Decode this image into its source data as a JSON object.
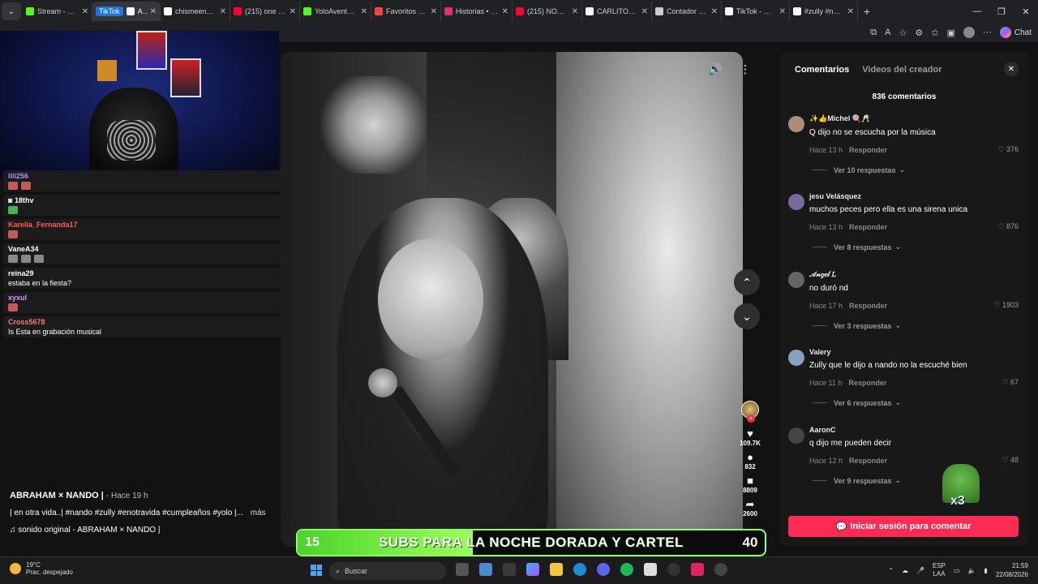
{
  "browser": {
    "tabs": [
      {
        "title": "Stream - Kick",
        "color": "#53fc18"
      },
      {
        "title": "ABRAHAM",
        "color": "#ffffff",
        "active": true,
        "pill": "TikTok"
      },
      {
        "title": "chismeenuna",
        "color": "#ffffff"
      },
      {
        "title": "(215) one dir",
        "color": "#ff0033"
      },
      {
        "title": "YoloAventuras",
        "color": "#53fc18"
      },
      {
        "title": "Favoritos | My",
        "color": "#ff4040"
      },
      {
        "title": "Historias • Inst",
        "color": "#e1306c"
      },
      {
        "title": "(215) NOS VA",
        "color": "#ff0033"
      },
      {
        "title": "CARLITOS TV",
        "color": "#ffffff"
      },
      {
        "title": "Contador en v",
        "color": "#cccccc"
      },
      {
        "title": "TikTok - Make",
        "color": "#ffffff"
      },
      {
        "title": "#zully #nando",
        "color": "#ffffff"
      }
    ],
    "chat_label": "Chat"
  },
  "video": {
    "author": "ABRAHAM × NANDO |",
    "time": "- Hace 19 h",
    "description": "| en otra vida..| #nando #zully #enotravida #cumpleaños #yolo |...",
    "more": "más",
    "sound": "sonido original - ABRAHAM × NANDO |",
    "likes": "109.7K",
    "comments": "832",
    "saves": "8809",
    "shares": "2600"
  },
  "stream_chat": [
    {
      "user": "lili256",
      "color": "#b58cff",
      "emotes": [
        "r",
        "r"
      ]
    },
    {
      "user": "18thv",
      "color": "#ffffff",
      "emotes": [
        "g"
      ],
      "badge": true
    },
    {
      "user": "Karelia_Fernanda17",
      "color": "#ff5a5a",
      "emotes": [
        "r"
      ]
    },
    {
      "user": "VaneA34",
      "color": "#ffffff",
      "emotes": [
        "gr",
        "gr",
        "gr"
      ]
    },
    {
      "user": "reina29",
      "color": "#ffffff",
      "msg": "estaba en la fiesta?"
    },
    {
      "user": "xyxul",
      "color": "#d59bff",
      "emotes": [
        "r"
      ]
    },
    {
      "user": "Cross5678",
      "color": "#ff7a7a",
      "msg": "Is Esta en grabación musical"
    }
  ],
  "comments": {
    "tab_comments": "Comentarios",
    "tab_creator": "Videos del creador",
    "count": "836 comentarios",
    "reply_label": "Responder",
    "items": [
      {
        "user": "✨👍Michel 🍭🥂",
        "text": "Q dijo no se escucha por la música",
        "time": "Hace 13 h",
        "likes": "376",
        "replies": "Ver 10 respuestas"
      },
      {
        "user": "jesu Velásquez",
        "text": "muchos peces pero ella es una sirena unica",
        "time": "Hace 13 h",
        "likes": "876",
        "replies": "Ver 8 respuestas"
      },
      {
        "user": "𝒜𝓃𝑔𝑒𝓁 𝐿",
        "text": "no duró nd",
        "time": "Hace 17 h",
        "likes": "1903",
        "replies": "Ver 3 respuestas"
      },
      {
        "user": "Valery",
        "text": "Zully que le dijo a nando no la escuché bien",
        "time": "Hace 11 h",
        "likes": "67",
        "replies": "Ver 6 respuestas"
      },
      {
        "user": "AaronC",
        "text": "q dijo me pueden decir",
        "time": "Hace 12 h",
        "likes": "48",
        "replies": "Ver 9 respuestas"
      }
    ],
    "login": "Iniciar sesión para comentar",
    "emote_text": "x3"
  },
  "subs_banner": {
    "current": "15",
    "goal": "40",
    "label": "SUBS PARA LA NOCHE DORADA Y CARTEL",
    "progress": 0.375
  },
  "taskbar": {
    "temp": "19°C",
    "weather": "Prac. despejado",
    "search": "Buscar",
    "lang1": "ESP",
    "lang2": "LAA",
    "time": "21:59",
    "date": "22/08/2026"
  }
}
